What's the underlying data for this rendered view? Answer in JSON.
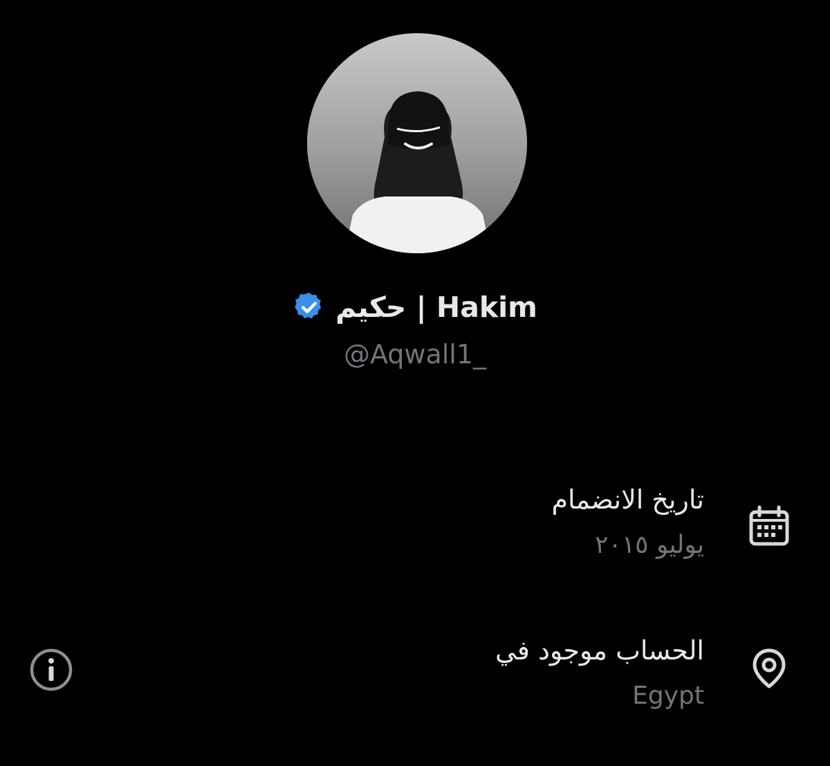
{
  "profile": {
    "display_name": "حكيم | Hakim",
    "handle": "@Aqwall1_",
    "verified_color": "#3b8ee8"
  },
  "details": {
    "joined_label": "تاريخ الانضمام",
    "joined_value": "يوليو ٢٠١٥",
    "location_label": "الحساب موجود في",
    "location_value": "Egypt"
  },
  "icons": {
    "calendar": "calendar-icon",
    "location": "map-pin-icon",
    "info": "info-icon",
    "verified": "verified-badge-icon"
  },
  "colors": {
    "background": "#000000",
    "primary_text": "#e7e9ea",
    "secondary_text": "#71767b",
    "icon": "#d6d9db",
    "info_icon": "#8b9096"
  }
}
